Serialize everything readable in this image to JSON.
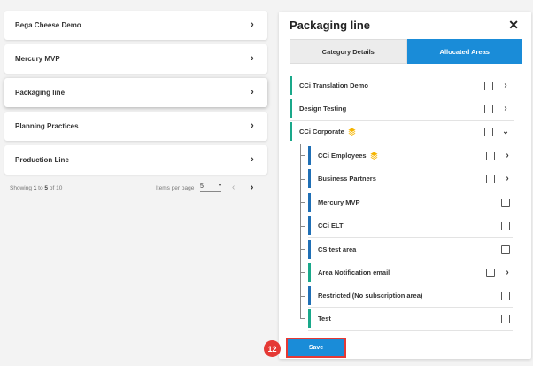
{
  "left_list": {
    "items": [
      {
        "label": "Bega Cheese Demo"
      },
      {
        "label": "Mercury MVP"
      },
      {
        "label": "Packaging line"
      },
      {
        "label": "Planning Practices"
      },
      {
        "label": "Production Line"
      }
    ]
  },
  "pager": {
    "showing_prefix": "Showing ",
    "range_start": "1",
    "range_mid": " to ",
    "range_end": "5",
    "of_text": " of 10",
    "items_per_page_label": "Items per page",
    "items_per_page_value": "5"
  },
  "panel": {
    "title": "Packaging line",
    "close_label": "✕",
    "tabs": [
      {
        "label": "Category Details"
      },
      {
        "label": "Allocated Areas"
      }
    ],
    "rows": [
      {
        "label": "CCi Translation Demo"
      },
      {
        "label": "Design Testing"
      },
      {
        "label": "CCi Corporate"
      },
      {
        "label": "CCi Employees"
      },
      {
        "label": "Business Partners"
      },
      {
        "label": "Mercury MVP"
      },
      {
        "label": "CCi ELT"
      },
      {
        "label": "CS test area"
      },
      {
        "label": "Area Notification email"
      },
      {
        "label": "Restricted (No subscription area)"
      },
      {
        "label": "Test"
      }
    ],
    "save_label": "Save",
    "step_badge": "12"
  },
  "colors": {
    "accent_blue": "#1a8cd8",
    "teal_bar": "#1aa88a",
    "dark_blue_bar": "#1f6fb5",
    "highlight_red": "#e53935",
    "layers_icon": "#f5b400"
  }
}
